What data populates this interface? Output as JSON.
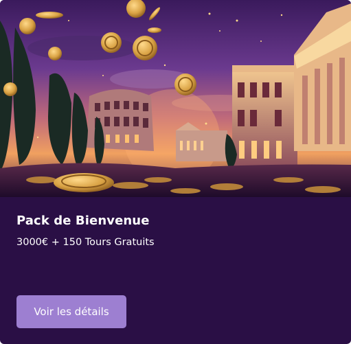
{
  "offer": {
    "title": "Pack de Bienvenue",
    "subtitle": "3000€ + 150 Tours Gratuits",
    "button_label": "Voir les détails"
  },
  "hero": {
    "subject": "Rome colosseum and palaces at dusk with golden casino coins"
  },
  "colors": {
    "card_background": "#2a0f45",
    "button_background": "#9d7fd1",
    "text": "#ffffff",
    "coin_gold": "#d9a244"
  }
}
